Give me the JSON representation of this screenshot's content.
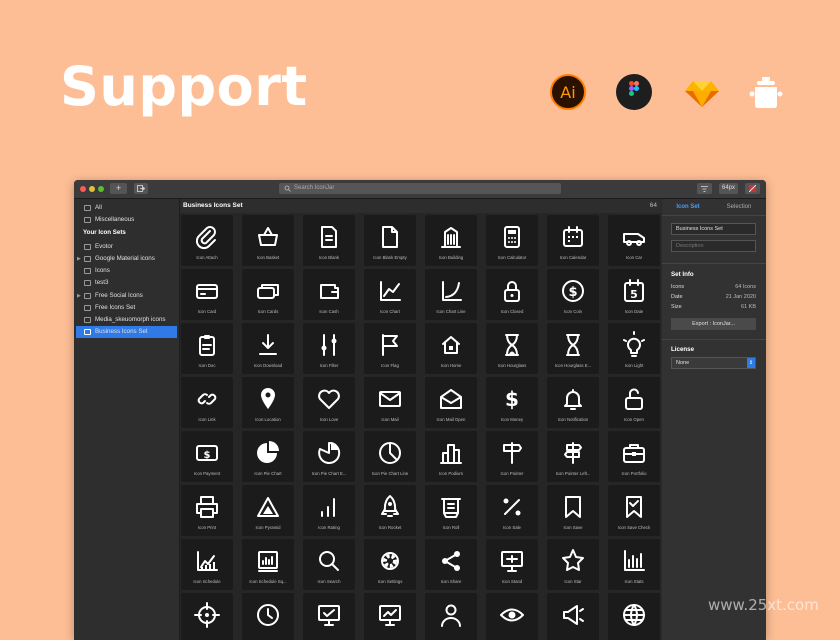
{
  "headline": "Support",
  "logos": [
    {
      "name": "illustrator-logo",
      "text": "Ai"
    },
    {
      "name": "figma-logo"
    },
    {
      "name": "sketch-logo"
    },
    {
      "name": "iconjar-logo"
    }
  ],
  "window": {
    "toolbar": {
      "add_label": "+",
      "search_placeholder": "Search IconJar",
      "size_label": "64px"
    },
    "sidebar": {
      "items_top": [
        "All",
        "Miscellaneous"
      ],
      "section_title": "Your Icon Sets",
      "sets": [
        "Evotor",
        "Google Material icons",
        "Icons",
        "test3",
        "Free Social Icons",
        "Free Icons Set",
        "Media_skeuomorph icons",
        "Business Icons Set"
      ],
      "selected": "Business Icons Set"
    },
    "main": {
      "title": "Business Icons Set",
      "count": "64",
      "icons": [
        "Icon Attach",
        "Icon Basket",
        "Icon Blank",
        "Icon Blank Empty",
        "Icon Building",
        "Icon Calculator",
        "Icon Calendar",
        "Icon Car",
        "Icon Card",
        "Icon Cards",
        "Icon Cash",
        "Icon Chart",
        "Icon Chart Line",
        "Icon Closed",
        "Icon Coin",
        "Icon Date",
        "Icon Doc",
        "Icon Download",
        "Icon Filter",
        "Icon Flag",
        "Icon Home",
        "Icon Hourglass",
        "Icon Hourglass E...",
        "Icon Light",
        "Icon Link",
        "Icon Location",
        "Icon Love",
        "Icon Mail",
        "Icon Mail Open",
        "Icon Money",
        "Icon Notification",
        "Icon Open",
        "Icon Payment",
        "Icon Pie Chart",
        "Icon Pie Chart E...",
        "Icon Pie Chart Line",
        "Icon Podium",
        "Icon Pointer",
        "Icon Pointer Left...",
        "Icon Portfolio",
        "Icon Print",
        "Icon Pyramid",
        "Icon Rating",
        "Icon Rocket",
        "Icon Roll",
        "Icon Sale",
        "Icon Save",
        "Icon Save Check",
        "Icon Schedule",
        "Icon Schedule Sq...",
        "Icon Search",
        "Icon Settings",
        "Icon Share",
        "Icon Stand",
        "Icon Star",
        "Icon Stats",
        "",
        "",
        "",
        "",
        "",
        "",
        "",
        ""
      ],
      "date_icon_number": "5"
    },
    "panel": {
      "tabs": [
        "Icon Set",
        "Selection"
      ],
      "name_value": "Business Icons Set",
      "description_placeholder": "Description",
      "set_info_title": "Set Info",
      "info": [
        {
          "label": "Icons",
          "value": "64 Icons"
        },
        {
          "label": "Date",
          "value": "21 Jan 2020"
        },
        {
          "label": "Size",
          "value": "61 KB"
        }
      ],
      "export_label": "Export : IconJar...",
      "license_title": "License",
      "license_value": "None"
    }
  },
  "watermark": "www.25xt.com"
}
